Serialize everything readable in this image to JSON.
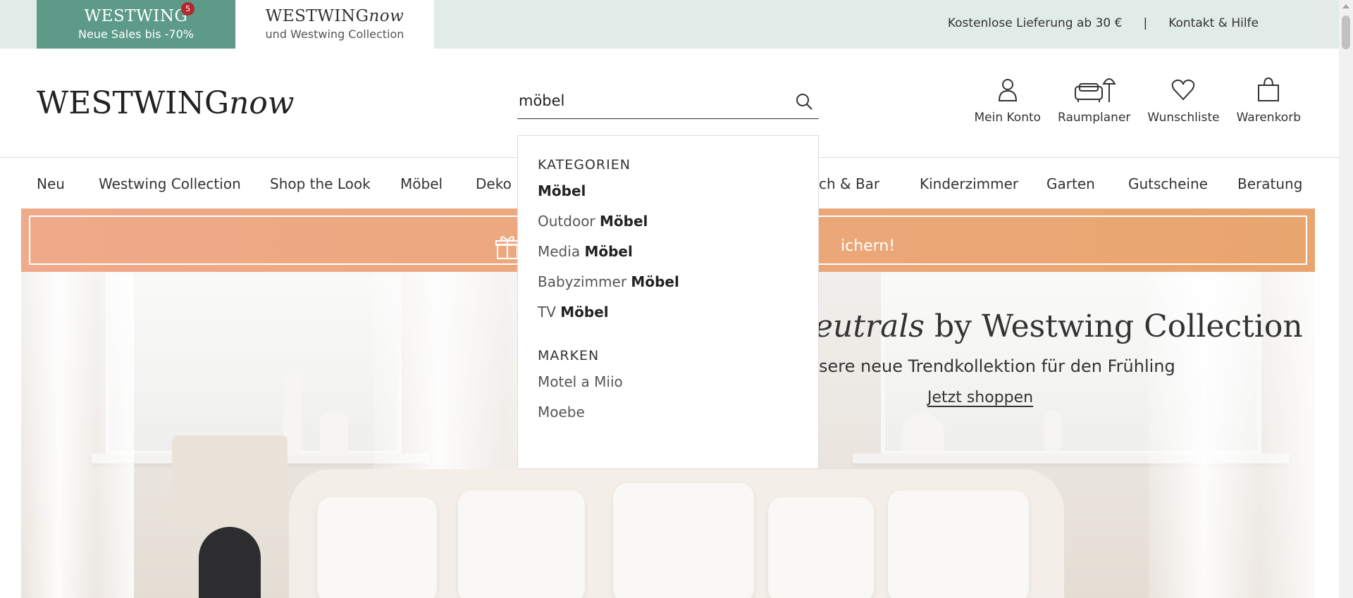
{
  "topbar": {
    "sales_brand": "WESTWING",
    "sales_badge": "5",
    "sales_subtitle": "Neue Sales bis -70%",
    "now_brand_1": "WESTWING",
    "now_brand_2": "now",
    "now_subtitle": "und Westwing Collection",
    "delivery_text": "Kostenlose Lieferung ab 30 €",
    "separator": "|",
    "help_link": "Kontakt & Hilfe"
  },
  "header": {
    "logo_1": "WESTWING",
    "logo_2": "now",
    "search_value": "möbel",
    "icons": [
      {
        "label": "Mein Konto",
        "icon": "user-icon"
      },
      {
        "label": "Raumplaner",
        "icon": "room-planner-icon"
      },
      {
        "label": "Wunschliste",
        "icon": "heart-icon"
      },
      {
        "label": "Warenkorb",
        "icon": "bag-icon"
      }
    ]
  },
  "nav": {
    "items": [
      "Neu",
      "Westwing Collection",
      "Shop the Look",
      "Möbel",
      "Deko",
      "isch & Bar",
      "Kinderzimmer",
      "Garten",
      "Gutscheine",
      "Beratung"
    ]
  },
  "promo": {
    "text": "ichern!"
  },
  "hero": {
    "title_italic": "eutrals",
    "title_rest": " by Westwing Collection",
    "subtitle": "sere neue Trendkollektion für den Frühling",
    "cta": "Jetzt shoppen"
  },
  "dropdown": {
    "categories_heading": "KATEGORIEN",
    "categories": [
      {
        "prefix": "",
        "match": "Möbel"
      },
      {
        "prefix": "Outdoor ",
        "match": "Möbel"
      },
      {
        "prefix": "Media ",
        "match": "Möbel"
      },
      {
        "prefix": "Babyzimmer ",
        "match": "Möbel"
      },
      {
        "prefix": "TV ",
        "match": "Möbel"
      }
    ],
    "brands_heading": "MARKEN",
    "brands": [
      "Motel a Miio",
      "Moebe"
    ]
  },
  "colors": {
    "sales_green": "#5d9b88",
    "topbar_bg": "#e1ebe8",
    "promo_orange": "#e9a56e",
    "badge_red": "#b3272f"
  }
}
